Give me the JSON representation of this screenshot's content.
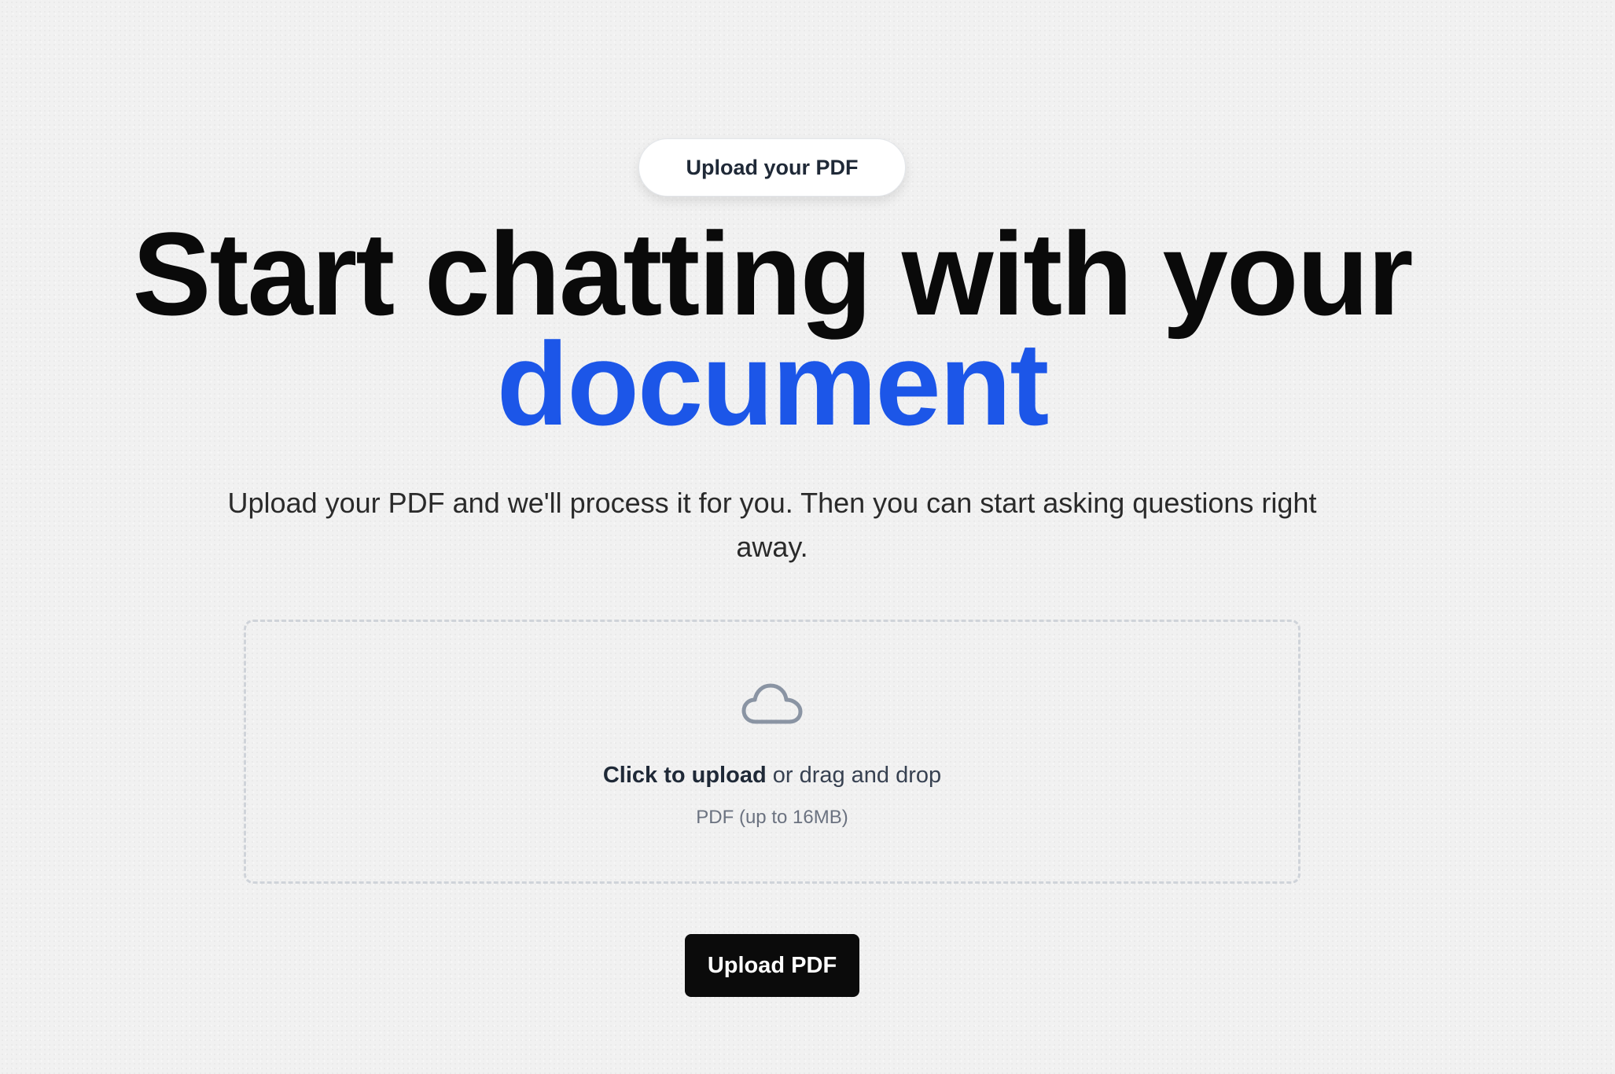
{
  "badge": {
    "label": "Upload your PDF"
  },
  "hero": {
    "title_line1": "Start chatting with your",
    "title_highlight": "document",
    "subtitle": "Upload your PDF and we'll process it for you. Then you can start asking questions right away."
  },
  "dropzone": {
    "icon": "cloud-icon",
    "click_label": "Click to upload",
    "drag_label": " or drag and drop",
    "hint": "PDF (up to 16MB)"
  },
  "actions": {
    "upload_label": "Upload PDF"
  },
  "colors": {
    "accent": "#1c56e8",
    "button_bg": "#0b0b0b",
    "page_bg": "#f1f1f1"
  }
}
